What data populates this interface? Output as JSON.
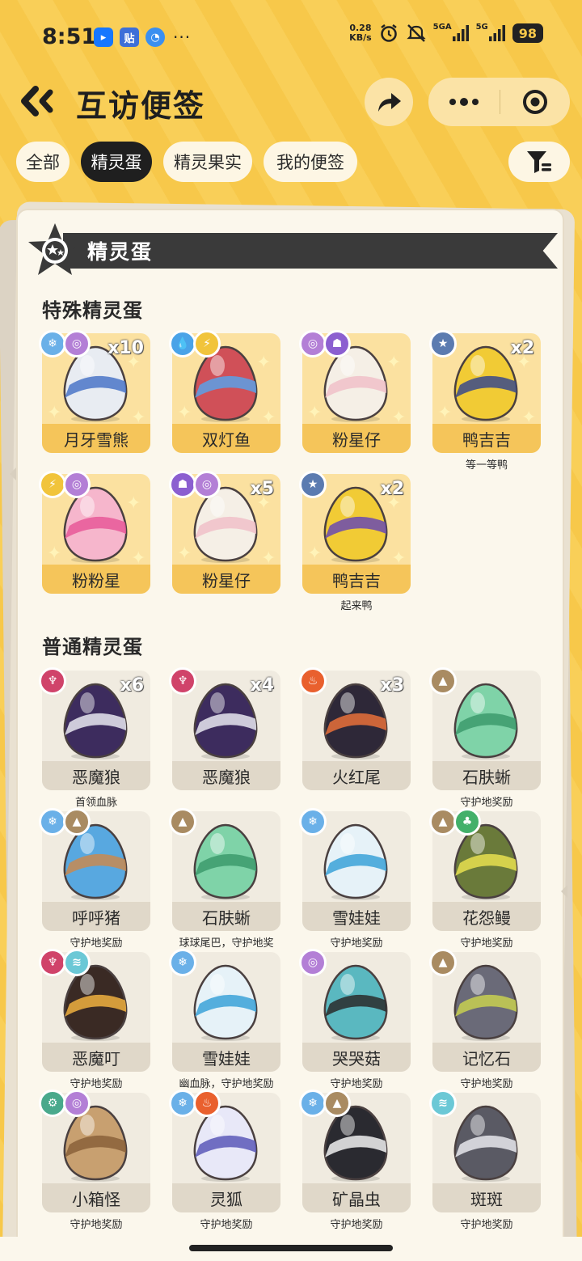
{
  "status": {
    "time": "8:51",
    "netspeed": "0.28\nKB/s",
    "netspeed_top": "0.28",
    "netspeed_bottom": "KB/s",
    "sig1_label": "5GA",
    "sig2_label": "5G",
    "battery": "98"
  },
  "header": {
    "title": "互访便签"
  },
  "tabs": [
    {
      "label": "全部",
      "active": false
    },
    {
      "label": "精灵蛋",
      "active": true
    },
    {
      "label": "精灵果实",
      "active": false
    },
    {
      "label": "我的便签",
      "active": false
    }
  ],
  "section": {
    "title": "精灵蛋"
  },
  "groups": {
    "special": {
      "title": "特殊精灵蛋",
      "items": [
        {
          "name": "月牙雪熊",
          "types": [
            "ice",
            "psy"
          ],
          "count": "x10",
          "note": "",
          "colors": [
            "#e8ecf2",
            "#4a76c8"
          ]
        },
        {
          "name": "双灯鱼",
          "types": [
            "water",
            "elec"
          ],
          "count": "",
          "note": "",
          "colors": [
            "#d05058",
            "#5aa0e8"
          ]
        },
        {
          "name": "粉星仔",
          "types": [
            "psy",
            "ghost"
          ],
          "count": "",
          "note": "",
          "colors": [
            "#f5efe6",
            "#f0c0c8"
          ]
        },
        {
          "name": "鸭吉吉",
          "types": [
            "normal"
          ],
          "count": "x2",
          "note": "等一等鸭",
          "colors": [
            "#f1cb35",
            "#3a4a8a"
          ]
        },
        {
          "name": "粉粉星",
          "types": [
            "elec",
            "psy"
          ],
          "count": "",
          "note": "",
          "colors": [
            "#f6b6cc",
            "#e85898"
          ]
        },
        {
          "name": "粉星仔",
          "types": [
            "ghost",
            "psy"
          ],
          "count": "x5",
          "note": "",
          "colors": [
            "#f5efe6",
            "#f0c0c8"
          ]
        },
        {
          "name": "鸭吉吉",
          "types": [
            "normal"
          ],
          "count": "x2",
          "note": "起来鸭",
          "colors": [
            "#f1cb35",
            "#6a4ab0"
          ]
        }
      ]
    },
    "normal": {
      "title": "普通精灵蛋",
      "items": [
        {
          "name": "恶魔狼",
          "types": [
            "dark"
          ],
          "count": "x6",
          "note": "首领血脉",
          "colors": [
            "#3d2c5e",
            "#e8e8f0"
          ]
        },
        {
          "name": "恶魔狼",
          "types": [
            "dark"
          ],
          "count": "x4",
          "note": "",
          "colors": [
            "#3d2c5e",
            "#e8e8f0"
          ]
        },
        {
          "name": "火红尾",
          "types": [
            "fire"
          ],
          "count": "x3",
          "note": "",
          "colors": [
            "#2e2838",
            "#e8703a"
          ]
        },
        {
          "name": "石肤蜥",
          "types": [
            "ground"
          ],
          "count": "",
          "note": "守护地奖励",
          "colors": [
            "#7fd3a8",
            "#3c9a6c"
          ]
        },
        {
          "name": "呼呼猪",
          "types": [
            "ice",
            "ground"
          ],
          "count": "",
          "note": "守护地奖励",
          "colors": [
            "#58a8e0",
            "#c88a50"
          ]
        },
        {
          "name": "石肤蜥",
          "types": [
            "ground"
          ],
          "count": "",
          "note": "球球尾巴，守护地奖",
          "colors": [
            "#7fd3a8",
            "#3c9a6c"
          ]
        },
        {
          "name": "雪娃娃",
          "types": [
            "ice"
          ],
          "count": "",
          "note": "守护地奖励",
          "colors": [
            "#e6f2f8",
            "#3aa2d8"
          ]
        },
        {
          "name": "花怨鳗",
          "types": [
            "ground",
            "grass"
          ],
          "count": "",
          "note": "守护地奖励",
          "colors": [
            "#6a7a3a",
            "#e8e050"
          ]
        },
        {
          "name": "恶魔叮",
          "types": [
            "dark",
            "wind"
          ],
          "count": "",
          "note": "守护地奖励",
          "colors": [
            "#3a2a24",
            "#f0b040"
          ]
        },
        {
          "name": "雪娃娃",
          "types": [
            "ice"
          ],
          "count": "",
          "note": "幽血脉，守护地奖励",
          "colors": [
            "#e6f2f8",
            "#3aa2d8"
          ]
        },
        {
          "name": "哭哭菇",
          "types": [
            "psy"
          ],
          "count": "",
          "note": "守护地奖励",
          "colors": [
            "#5ab8c0",
            "#2a2a2a"
          ]
        },
        {
          "name": "记忆石",
          "types": [
            "ground"
          ],
          "count": "",
          "note": "守护地奖励",
          "colors": [
            "#6a6a78",
            "#c8d050"
          ]
        },
        {
          "name": "小箱怪",
          "types": [
            "mech",
            "psy"
          ],
          "count": "",
          "note": "守护地奖励",
          "colors": [
            "#c8a070",
            "#8a6038"
          ]
        },
        {
          "name": "灵狐",
          "types": [
            "ice",
            "fire"
          ],
          "count": "",
          "note": "守护地奖励",
          "colors": [
            "#e8e8f8",
            "#5a58b8"
          ]
        },
        {
          "name": "矿晶虫",
          "types": [
            "ice",
            "ground"
          ],
          "count": "",
          "note": "守护地奖励",
          "colors": [
            "#2a2a30",
            "#f0f0f0"
          ]
        },
        {
          "name": "斑斑",
          "types": [
            "wind"
          ],
          "count": "",
          "note": "守护地奖励",
          "colors": [
            "#5a5a64",
            "#e8e8ec"
          ]
        }
      ]
    }
  },
  "type_icons": {
    "ice": "snowflake-icon",
    "psy": "spiral-icon",
    "water": "drop-icon",
    "elec": "bolt-icon",
    "ghost": "ghost-icon",
    "normal": "star-icon",
    "dark": "demon-icon",
    "fire": "flame-icon",
    "ground": "mountain-icon",
    "grass": "leaf-icon",
    "wind": "wing-icon",
    "mech": "gear-icon"
  }
}
